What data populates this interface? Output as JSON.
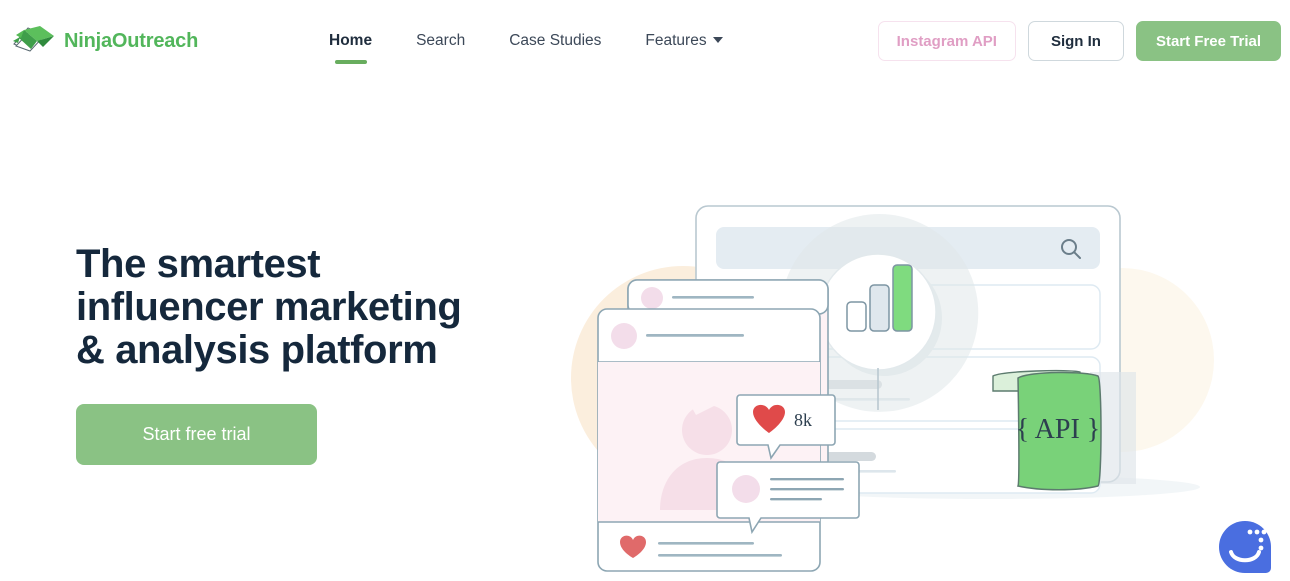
{
  "brand": {
    "name": "NinjaOutreach",
    "logo_icon": "ninja-envelope-logo",
    "color": "#52b65b"
  },
  "nav": {
    "items": [
      {
        "label": "Home",
        "active": true,
        "has_dropdown": false
      },
      {
        "label": "Search",
        "active": false,
        "has_dropdown": false
      },
      {
        "label": "Case Studies",
        "active": false,
        "has_dropdown": false
      },
      {
        "label": "Features",
        "active": false,
        "has_dropdown": true
      }
    ],
    "dropdown_icon": "chevron-down-icon",
    "active_underline_color": "#68ad5e"
  },
  "header_actions": {
    "instagram_api": {
      "label": "Instagram API",
      "text_color": "#e09ec4",
      "border_color": "#f6e2ee"
    },
    "sign_in": {
      "label": "Sign In",
      "text_color": "#1f2d3d",
      "border_color": "#cfd8dd"
    },
    "start_free_trial": {
      "label": "Start Free Trial",
      "bg_color": "#8ac284",
      "text_color": "#ffffff"
    }
  },
  "hero": {
    "title_line_1": "The smartest",
    "title_line_2": "influencer marketing",
    "title_line_3": "& analysis platform",
    "title_color": "#15283c",
    "cta_label": "Start free trial",
    "cta_bg_color": "#8ac284"
  },
  "illustration": {
    "name": "influencer-analytics-illustration",
    "blob_peach_color": "#fbeedd",
    "blob_cream_color": "#fdf8ee",
    "badge": {
      "name": "analytics-badge",
      "icon": "bar-chart-icon",
      "bars": [
        {
          "height_pct": 28,
          "fill": "#ffffff"
        },
        {
          "height_pct": 62,
          "fill": "#dfe7ed"
        },
        {
          "height_pct": 100,
          "fill": "#7fdb7f"
        }
      ]
    },
    "dashed_path": {
      "name": "dashed-trajectory-path",
      "color": "#8fa3ae"
    },
    "social_post": {
      "name": "social-post-card",
      "avatar_color": "#f3ddea",
      "photo_bg_color": "#fdf2f5",
      "silhouette_color": "#f6dfe8",
      "heart_icon": "heart-icon",
      "heart_color": "#e06a6a"
    },
    "like_tooltip": {
      "name": "like-count-tooltip",
      "icon": "heart-icon",
      "count": "8k"
    },
    "comment_bubble": {
      "name": "comment-bubble",
      "avatar_color": "#f3ddea"
    },
    "results_panel": {
      "name": "search-results-panel",
      "search_icon": "search-icon",
      "search_bar_color": "#e4ecf2",
      "rows": [
        {
          "name": "result-row",
          "avatar_color": "#d7e7f2"
        },
        {
          "name": "result-row",
          "avatar_color": "#d7e7f2"
        },
        {
          "name": "result-row",
          "avatar_color": "#d7e7f2"
        }
      ]
    },
    "api_scroll": {
      "name": "api-scroll",
      "label": "{ API }",
      "bg_color": "#79d279",
      "top_color": "#dbf0da",
      "text_color": "#2d3f4f"
    }
  },
  "chat_widget": {
    "name": "chat-widget-button",
    "icon": "chat-smile-icon",
    "color": "#4a6ee0"
  }
}
